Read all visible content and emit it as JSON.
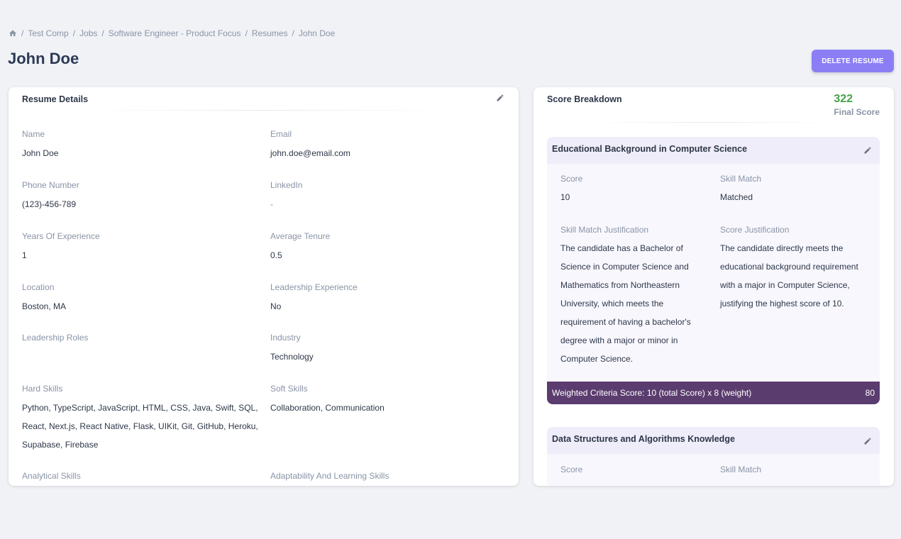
{
  "breadcrumb": [
    "Test Comp",
    "Jobs",
    "Software Engineer - Product Focus",
    "Resumes",
    "John Doe"
  ],
  "page_title": "John Doe",
  "delete_label": "DELETE RESUME",
  "resume": {
    "title": "Resume Details",
    "fields": [
      {
        "label": "Name",
        "value": "John Doe"
      },
      {
        "label": "Email",
        "value": "john.doe@email.com"
      },
      {
        "label": "Phone Number",
        "value": "(123)-456-789"
      },
      {
        "label": "LinkedIn",
        "value": "-"
      },
      {
        "label": "Years Of Experience",
        "value": "1"
      },
      {
        "label": "Average Tenure",
        "value": "0.5"
      },
      {
        "label": "Location",
        "value": "Boston, MA"
      },
      {
        "label": "Leadership Experience",
        "value": "No"
      },
      {
        "label": "Leadership Roles",
        "value": ""
      },
      {
        "label": "Industry",
        "value": "Technology"
      },
      {
        "label": "Hard Skills",
        "value": "Python, TypeScript, JavaScript, HTML, CSS, Java, Swift, SQL, React, Next.js, React Native, Flask, UIKit, Git, GitHub, Heroku, Supabase, Firebase"
      },
      {
        "label": "Soft Skills",
        "value": "Collaboration, Communication"
      },
      {
        "label": "Analytical Skills",
        "value": ""
      },
      {
        "label": "Adaptability And Learning Skills",
        "value": ""
      }
    ]
  },
  "score": {
    "title": "Score Breakdown",
    "final_score": "322",
    "final_label": "Final Score",
    "criteria": [
      {
        "title": "Educational Background in Computer Science",
        "score_label": "Score",
        "score": "10",
        "match_label": "Skill Match",
        "match": "Matched",
        "match_just_label": "Skill Match Justification",
        "match_just": "The candidate has a Bachelor of Science in Computer Science and Mathematics from Northeastern University, which meets the requirement of having a bachelor's degree with a major or minor in Computer Science.",
        "score_just_label": "Score Justification",
        "score_just": "The candidate directly meets the educational background requirement with a major in Computer Science, justifying the highest score of 10.",
        "weighted_text": "Weighted Criteria Score: 10 (total Score) x 8 (weight)",
        "weighted_value": "80"
      },
      {
        "title": "Data Structures and Algorithms Knowledge",
        "score_label": "Score",
        "match_label": "Skill Match"
      }
    ]
  },
  "colors": {
    "accent_button": "#8b7ef5",
    "final_score": "#43a047",
    "weighted_footer": "#5b3c6e"
  }
}
